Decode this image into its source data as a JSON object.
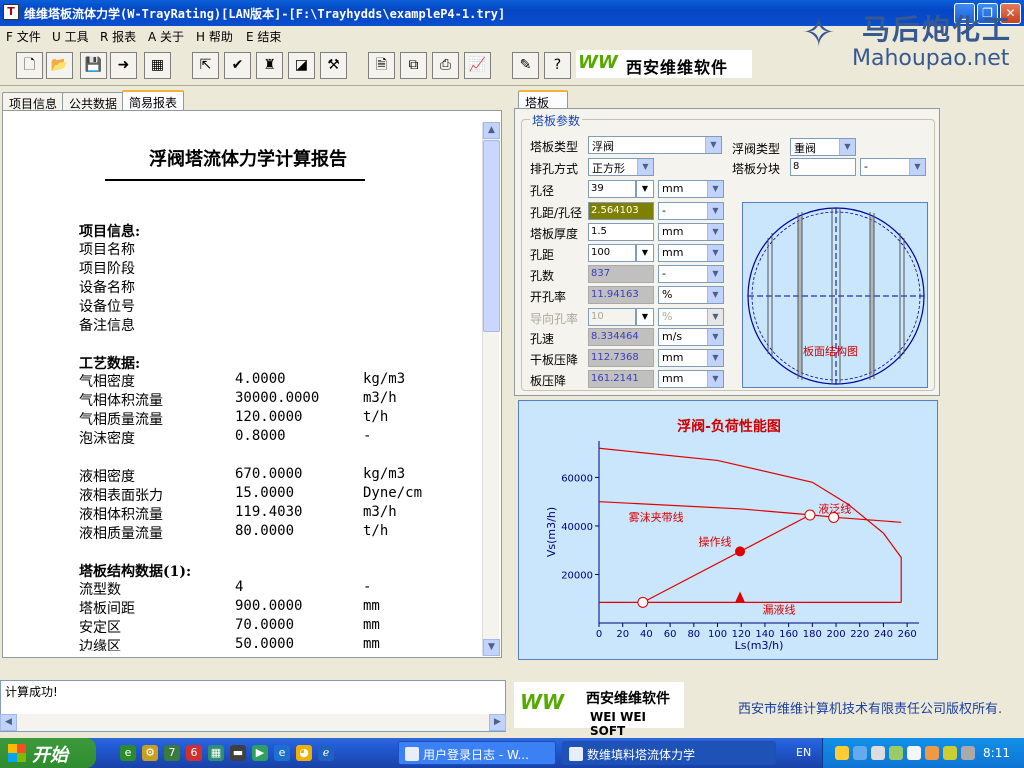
{
  "window": {
    "title": "维维塔板流体力学(W-TrayRating)[LAN版本]-[F:\\Trayhydds\\exampleP4-1.try]",
    "icon": "app-icon"
  },
  "watermark": {
    "brand": "马后炮化工",
    "url": "Mahoupao.net"
  },
  "menu": [
    {
      "key": "F",
      "label": "文件"
    },
    {
      "key": "U",
      "label": "工具"
    },
    {
      "key": "R",
      "label": "报表"
    },
    {
      "key": "A",
      "label": "关于"
    },
    {
      "key": "H",
      "label": "帮助"
    },
    {
      "key": "E",
      "label": "结束"
    }
  ],
  "toolbar": {
    "brand": "西安维维软件",
    "brand_logo": "WW"
  },
  "left_tabs": [
    "项目信息",
    "公共数据",
    "简易报表"
  ],
  "report": {
    "title": "浮阀塔流体力学计算报告",
    "sections": [
      {
        "heading": "项目信息:",
        "rows": [
          [
            "项目名称",
            "",
            ""
          ],
          [
            "项目阶段",
            "",
            ""
          ],
          [
            "设备名称",
            "",
            ""
          ],
          [
            "设备位号",
            "",
            ""
          ],
          [
            "备注信息",
            "",
            ""
          ]
        ]
      },
      {
        "heading": "工艺数据:",
        "rows": [
          [
            "气相密度",
            "4.0000",
            "kg/m3"
          ],
          [
            "气相体积流量",
            "30000.0000",
            "m3/h"
          ],
          [
            "气相质量流量",
            "120.0000",
            "t/h"
          ],
          [
            "泡沫密度",
            "0.8000",
            "-"
          ],
          [
            "",
            "",
            ""
          ],
          [
            "液相密度",
            "670.0000",
            "kg/m3"
          ],
          [
            "液相表面张力",
            "15.0000",
            "Dyne/cm"
          ],
          [
            "液相体积流量",
            "119.4030",
            "m3/h"
          ],
          [
            "液相质量流量",
            "80.0000",
            "t/h"
          ]
        ]
      },
      {
        "heading": "塔板结构数据(1):",
        "rows": [
          [
            "流型数",
            "4",
            "-"
          ],
          [
            "塔板间距",
            "900.0000",
            "mm"
          ],
          [
            "安定区",
            "70.0000",
            "mm"
          ],
          [
            "边缘区",
            "50.0000",
            "mm"
          ]
        ]
      }
    ]
  },
  "right_tab": "塔板",
  "params": {
    "group_title": "塔板参数",
    "tray_type": {
      "label": "塔板类型",
      "value": "浮阀"
    },
    "valve_type": {
      "label": "浮阀类型",
      "value": "重阀"
    },
    "hole_pattern": {
      "label": "排孔方式",
      "value": "正方形"
    },
    "tray_split": {
      "label": "塔板分块",
      "value": "8",
      "unit": "-"
    },
    "rows": [
      {
        "label": "孔径",
        "value": "39",
        "unit": "mm",
        "style": "normal",
        "combo": true
      },
      {
        "label": "孔距/孔径",
        "value": "2.564103",
        "unit": "-",
        "style": "olive"
      },
      {
        "label": "塔板厚度",
        "value": "1.5",
        "unit": "mm",
        "style": "normal"
      },
      {
        "label": "孔距",
        "value": "100",
        "unit": "mm",
        "style": "normal",
        "combo": true
      },
      {
        "label": "孔数",
        "value": "837",
        "unit": "-",
        "style": "ro"
      },
      {
        "label": "开孔率",
        "value": "11.94163",
        "unit": "%",
        "style": "ro"
      },
      {
        "label": "导向孔率",
        "value": "10",
        "unit": "%",
        "style": "dis",
        "combo": true
      },
      {
        "label": "孔速",
        "value": "8.334464",
        "unit": "m/s",
        "style": "ro"
      },
      {
        "label": "干板压降",
        "value": "112.7368",
        "unit": "mm",
        "style": "ro"
      },
      {
        "label": "板压降",
        "value": "161.2141",
        "unit": "mm",
        "style": "ro"
      }
    ],
    "diagram_label": "板面结构图"
  },
  "chart_data": {
    "type": "line",
    "title": "浮阀-负荷性能图",
    "xlabel": "Ls(m3/h)",
    "ylabel": "Vs(m3/h)",
    "xlim": [
      0,
      270
    ],
    "ylim": [
      0,
      75000
    ],
    "xticks": [
      0,
      20,
      40,
      60,
      80,
      100,
      120,
      140,
      160,
      180,
      200,
      220,
      240,
      260
    ],
    "yticks": [
      20000,
      40000,
      60000
    ],
    "series": [
      {
        "name": "雾沫夹带线",
        "x": [
          0,
          120,
          180,
          200,
          255
        ],
        "y": [
          50000,
          47000,
          44500,
          43500,
          41500
        ]
      },
      {
        "name": "液泛线",
        "x": [
          0,
          100,
          180,
          210,
          240,
          255,
          255
        ],
        "y": [
          72000,
          67000,
          58000,
          49000,
          37000,
          27000,
          8500
        ]
      },
      {
        "name": "漏液线",
        "x": [
          0,
          255
        ],
        "y": [
          8500,
          8500
        ]
      },
      {
        "name": "操作线",
        "x": [
          37,
          178
        ],
        "y": [
          8500,
          44500
        ]
      }
    ],
    "operating_point": {
      "x": 119,
      "y": 29500
    },
    "lower_limit_point": {
      "x": 119,
      "y": 10500
    },
    "open_points": [
      {
        "x": 37,
        "y": 8500
      },
      {
        "x": 178,
        "y": 44500
      },
      {
        "x": 198,
        "y": 43500
      }
    ],
    "labels": [
      {
        "text": "雾沫夹带线",
        "x": 25,
        "y": 42000
      },
      {
        "text": "液泛线",
        "x": 185,
        "y": 45500
      },
      {
        "text": "操作线",
        "x": 84,
        "y": 32000
      },
      {
        "text": "漏液线",
        "x": 138,
        "y": 4000
      }
    ],
    "colors": {
      "curve": "#e00000",
      "axis": "#000080",
      "title": "#d00000",
      "background": "#c9e6fc"
    }
  },
  "status": {
    "message": "计算成功!"
  },
  "footer": {
    "brand_logo": "WW",
    "brand": "西安维维软件",
    "brand_en": "WEI WEI SOFT",
    "copyright": "西安市维维计算机技术有限责任公司版权所有."
  },
  "taskbar": {
    "start": "开始",
    "tasks": [
      "用户登录日志 - W...",
      "数维填料塔流体力学"
    ],
    "lang": "EN",
    "clock": "8:11"
  }
}
